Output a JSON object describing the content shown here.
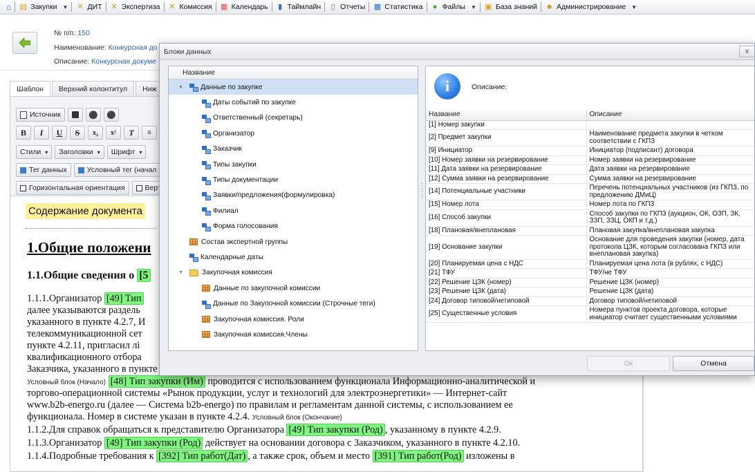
{
  "topbar": {
    "items": [
      {
        "label": "Закупки",
        "icon": "cart-icon",
        "caret": true
      },
      {
        "label": "ДИТ",
        "icon": "tools-icon"
      },
      {
        "label": "Экспертиза",
        "icon": "tools-icon"
      },
      {
        "label": "Комиссия",
        "icon": "tools-icon"
      },
      {
        "label": "Календарь",
        "icon": "calendar-icon"
      },
      {
        "label": "Таймлайн",
        "icon": "timeline-icon"
      },
      {
        "label": "Отчеты",
        "icon": "report-icon"
      },
      {
        "label": "Статистика",
        "icon": "stats-icon"
      },
      {
        "label": "Файлы",
        "icon": "files-icon",
        "caret": true
      },
      {
        "label": "База знаний",
        "icon": "knowledge-icon"
      },
      {
        "label": "Администрирование",
        "icon": "admin-icon",
        "caret": true
      }
    ]
  },
  "record": {
    "num_label": "№ п/п:",
    "num_value": "150",
    "name_label": "Наименование:",
    "name_value": "Конкурсная до",
    "desc_label": "Описание:",
    "desc_value": "Конкурсная докуме"
  },
  "editor": {
    "tabs": [
      "Шаблон",
      "Верхний колонтитул",
      "Ниж"
    ],
    "toolbar": {
      "source": "Источник",
      "styles": "Стили",
      "headings": "Заголовки",
      "font": "Шрифт",
      "data_tag": "Тег данных",
      "cond_tag": "Условный тег (начал",
      "horizontal": "Горизонтальная ориентация",
      "vertical": "Верт"
    },
    "doc": {
      "banner": "Содержание документа",
      "h1": "1.Общие положени",
      "h2": "1.1.Общие сведения о",
      "h2_tag": "[5",
      "p1_a": "1.1.1.Организатор",
      "p1_tag": "[49] Тип",
      "p2": "далее указываются раздель",
      "p3": "указанного в пункте 4.2.7, И",
      "p4": "телекоммуникационной сет",
      "p5": "пункте 4.2.11, пригласил лі",
      "p6": "квалификационного отбора",
      "p7": "Заказчика, указанного в пункте 4.2.7.",
      "cond_start": "Условный блок (Начало)",
      "p8_tag": "[48] Тип закупки (Им)",
      "p8_text": "проводится с использованием функционала Информационно-аналитической и",
      "p9": "торгово-операционной системы «Рынок продукции, услуг и технологий для электроэнергетики» — Интернет-сайт",
      "p10": "www.b2b-energo.ru (далее — Система b2b-energo) по правилам и регламентам данной системы, с использованием ее",
      "p11": "функционала. Номер в системе указан в пункте 4.2.4.",
      "cond_end": "Условный блок (Окончание)",
      "p12_a": "1.1.2.Для справок обращаться к представителю Организатора",
      "p12_tag": "[49] Тип закупки (Род)",
      "p12_b": ", указанному в пункте 4.2.9.",
      "p13_a": "1.1.3.Организатор",
      "p13_tag": "[49] Тип закупки (Род)",
      "p13_b": "действует на основании договора с Заказчиком, указанного в пункте 4.2.10.",
      "p14_a": "1.1.4.Подробные требования к",
      "p14_tag1": "[392] Тип работ(Дат)",
      "p14_b": ", а также срок, объем и место",
      "p14_tag2": "[391] Тип работ(Род)",
      "p14_c": "изложены в"
    }
  },
  "dialog": {
    "title": "Блоки данных",
    "close": "x",
    "tree_header": "Название",
    "tree": [
      {
        "label": "Данные по закупке",
        "icon": "tag",
        "level": 0,
        "expanded": true,
        "selected": true
      },
      {
        "label": "Даты событий по закупке",
        "icon": "tag",
        "level": 1
      },
      {
        "label": "Ответственный (секретарь)",
        "icon": "tag",
        "level": 1
      },
      {
        "label": "Организатор",
        "icon": "tag",
        "level": 1
      },
      {
        "label": "Заказчик",
        "icon": "tag",
        "level": 1
      },
      {
        "label": "Типы закупки",
        "icon": "tag",
        "level": 1
      },
      {
        "label": "Типы документации",
        "icon": "tag",
        "level": 1
      },
      {
        "label": "Заявки/предложения(формулировка)",
        "icon": "tag",
        "level": 1
      },
      {
        "label": "Филиал",
        "icon": "tag",
        "level": 1
      },
      {
        "label": "Форма голосования",
        "icon": "tag",
        "level": 1
      },
      {
        "label": "Состав экспертной группы",
        "icon": "table",
        "level": 0
      },
      {
        "label": "Календарные даты",
        "icon": "tag",
        "level": 0
      },
      {
        "label": "Закупочная комиссия",
        "icon": "folder",
        "level": 0,
        "expanded": true
      },
      {
        "label": "Данные по закупочной комиссии",
        "icon": "table",
        "level": 1
      },
      {
        "label": "Данные по Закупочной комиссии (Строчные теги)",
        "icon": "tag",
        "level": 1
      },
      {
        "label": "Закупочная комиссия. Роли",
        "icon": "table",
        "level": 1
      },
      {
        "label": "Закупочная комиссия.Члены",
        "icon": "table",
        "level": 1
      }
    ],
    "description_label": "Описание:",
    "table_headers": [
      "Название",
      "Описание"
    ],
    "rows": [
      {
        "name": "[1] Номер закупки",
        "desc": ""
      },
      {
        "name": "[2] Предмет закупки",
        "desc": "Наименование предмета закупки в четком соответствии с ГКПЗ"
      },
      {
        "name": "[9] Инициатор",
        "desc": "Инициатор (подписант) договора"
      },
      {
        "name": "[10] Номер заявки на резервирование",
        "desc": "Номер заявки на резервирование"
      },
      {
        "name": "[11] Дата заявки на резервирование",
        "desc": "Дата заявки на резервирование"
      },
      {
        "name": "[12] Сумма заявки на резервирование",
        "desc": "Сумма заявки на резервирование"
      },
      {
        "name": "[14] Потенциальные участники",
        "desc": "Перечень потенциальных участников (из ГКПЗ, по предложению ДМиЦ)"
      },
      {
        "name": "[15] Номер лота",
        "desc": "Номер лота по ГКПЗ"
      },
      {
        "name": "[16] Способ закупки",
        "desc": "Способ закупки по ГКПЗ (аукцион, ОК, ОЗП, ЗК, ЗЗП, ЗЗЦ, ОКП и т.д.)"
      },
      {
        "name": "[18] Плановая/внеплановая",
        "desc": "Плановая закупка/внеплановая закупка"
      },
      {
        "name": "[19] Основание закупки",
        "desc": "Основание для проведения закупки (номер, дата протокола ЦЗК, которым согласована ГКПЗ или внеплановая закупка)"
      },
      {
        "name": "[20] Планируемая цена с НДС",
        "desc": "Планируемая цена лота (в рублях, с НДС)"
      },
      {
        "name": "[21] ТФУ",
        "desc": "ТФУ/не ТФУ"
      },
      {
        "name": "[22] Решение ЦЗК (номер)",
        "desc": "Решение ЦЗК (номер)"
      },
      {
        "name": "[23] Решение ЦЗК (дата)",
        "desc": "Решение ЦЗК (дата)"
      },
      {
        "name": "[24] Договор типовой/нетиповой",
        "desc": "Договор типовой/нетиповой"
      },
      {
        "name": "[25] Существенные условия",
        "desc": "Номера пунктов проекта договора, которые инициатор считает существенными условиями"
      }
    ],
    "ok": "Ок",
    "cancel": "Отмена"
  }
}
